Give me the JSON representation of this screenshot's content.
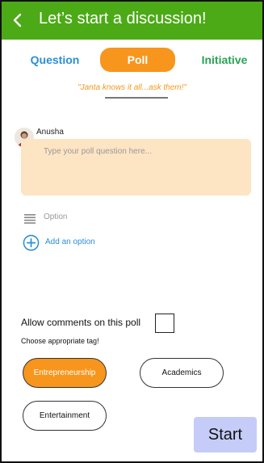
{
  "appbar": {
    "title": "Let’s start a discussion!",
    "back_icon": "chevron-left-icon",
    "background": "#4caa16"
  },
  "tabs": [
    {
      "label": "Question",
      "color": "#2b8fd6",
      "selected": false
    },
    {
      "label": "Poll",
      "color": "#f7951d",
      "selected": true
    },
    {
      "label": "Initiative",
      "color": "#2aa157",
      "selected": false
    }
  ],
  "tagline": "\"Janta knows it all...ask them!\"",
  "author": {
    "name": "Anusha"
  },
  "poll": {
    "question_placeholder": "Type your poll question here...",
    "question_value": "",
    "option_placeholder": "Option",
    "add_option_label": "Add an option"
  },
  "comments": {
    "label": "Allow comments on this poll",
    "checked": false
  },
  "tags": {
    "heading": "Choose appropriate tag!",
    "items": [
      {
        "label": "Entrepreneurship",
        "selected": true
      },
      {
        "label": "Academics",
        "selected": false
      },
      {
        "label": "Entertainment",
        "selected": false
      }
    ]
  },
  "start_label": "Start"
}
